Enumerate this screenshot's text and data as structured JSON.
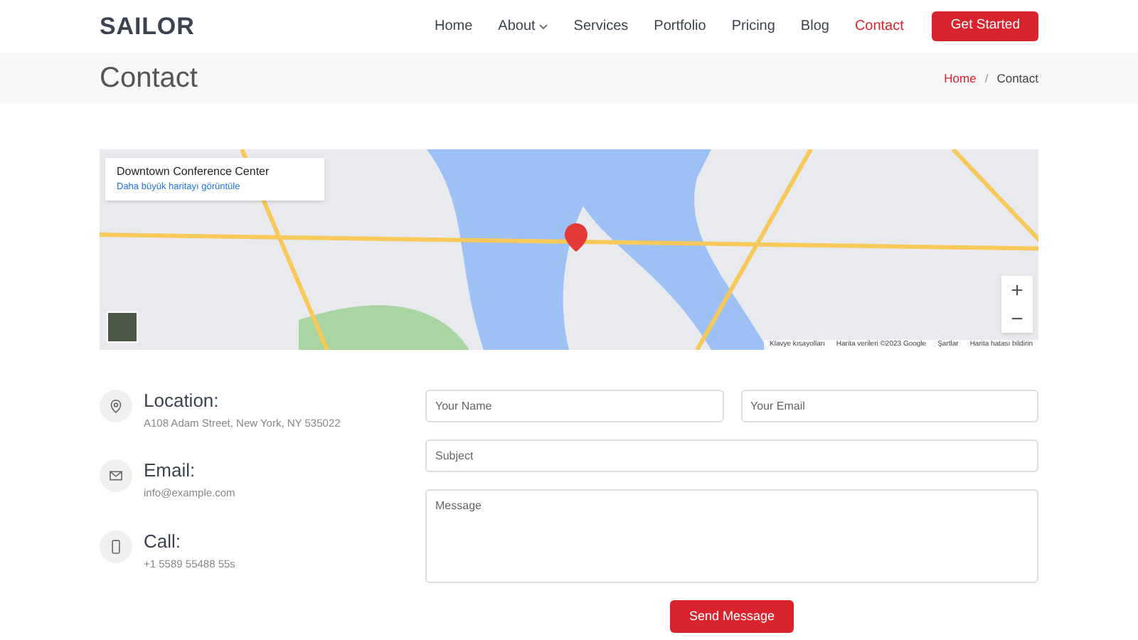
{
  "header": {
    "logo": "SAILOR",
    "nav": [
      {
        "label": "Home",
        "selected": false,
        "dropdown": false
      },
      {
        "label": "About",
        "selected": false,
        "dropdown": true
      },
      {
        "label": "Services",
        "selected": false,
        "dropdown": false
      },
      {
        "label": "Portfolio",
        "selected": false,
        "dropdown": false
      },
      {
        "label": "Pricing",
        "selected": false,
        "dropdown": false
      },
      {
        "label": "Blog",
        "selected": false,
        "dropdown": false
      },
      {
        "label": "Contact",
        "selected": true,
        "dropdown": false
      }
    ],
    "cta": "Get Started"
  },
  "page_title": {
    "title": "Contact",
    "breadcrumbs": [
      "Home",
      "Contact"
    ],
    "separator": "/"
  },
  "map": {
    "place_card": {
      "title": "Downtown Conference Center",
      "link": "Daha büyük haritayı görüntüle"
    },
    "zoom_in": "+",
    "zoom_out": "−",
    "attribution": [
      "Klavye kısayolları",
      "Harita verileri ©2023 Google",
      "Şartlar",
      "Harita hatası bildirin"
    ]
  },
  "contact_info": [
    {
      "kind": "location",
      "title": "Location:",
      "text": "A108 Adam Street, New York, NY 535022"
    },
    {
      "kind": "email",
      "title": "Email:",
      "text": "info@example.com"
    },
    {
      "kind": "phone",
      "title": "Call:",
      "text": "+1 5589 55488 55s"
    }
  ],
  "form": {
    "name": {
      "placeholder": "Your Name"
    },
    "email": {
      "placeholder": "Your Email"
    },
    "subject": {
      "placeholder": "Subject"
    },
    "message": {
      "placeholder": "Message"
    },
    "submit": "Send Message"
  }
}
